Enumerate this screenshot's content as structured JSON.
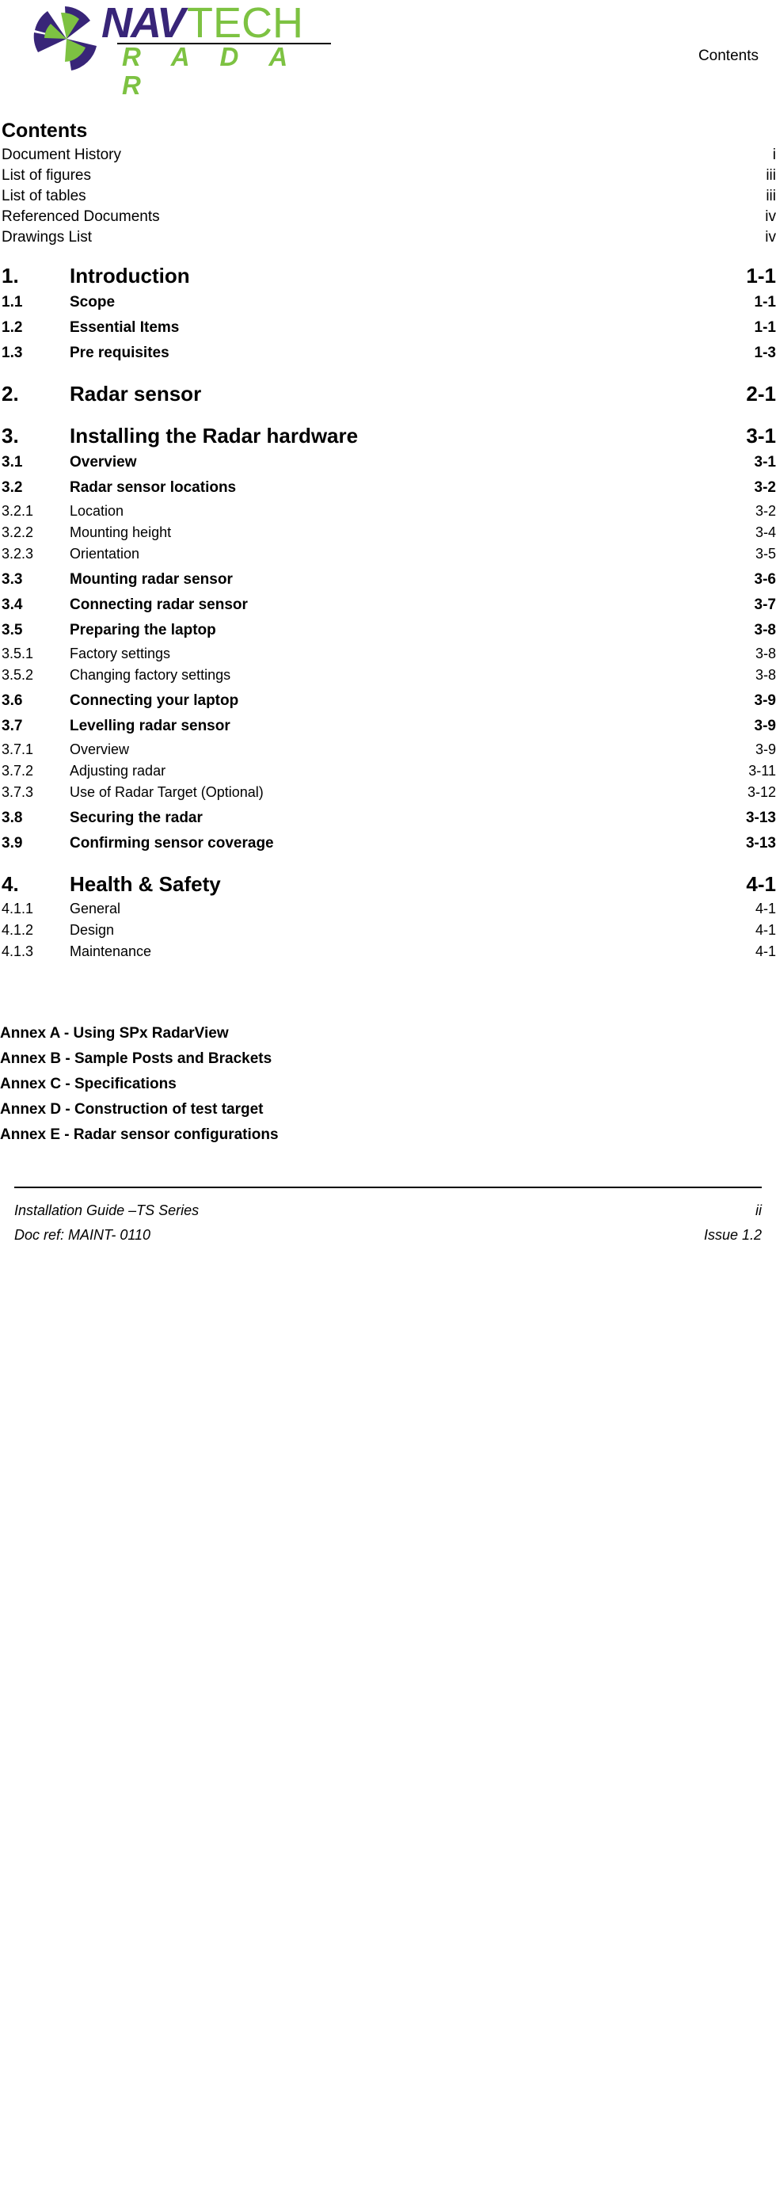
{
  "header": {
    "logo": {
      "brand_part1": "NAV",
      "brand_part2": "TECH",
      "brand_part3": "R A D A R",
      "color_purple": "#382578",
      "color_green": "#7dc242"
    },
    "running_title": "Contents"
  },
  "toc": {
    "heading": "Contents",
    "front_matter": [
      {
        "title": "Document History",
        "page": "i"
      },
      {
        "title": "List of figures",
        "page": "iii"
      },
      {
        "title": "List of tables",
        "page": "iii"
      },
      {
        "title": "Referenced Documents",
        "page": "iv"
      },
      {
        "title": "Drawings List",
        "page": "iv"
      }
    ],
    "entries": [
      {
        "num": "1.",
        "title": "Introduction",
        "page": "1-1",
        "level": 1
      },
      {
        "num": "1.1",
        "title": "Scope",
        "page": "1-1",
        "level": 2
      },
      {
        "num": "1.2",
        "title": "Essential Items",
        "page": "1-1",
        "level": 2
      },
      {
        "num": "1.3",
        "title": "Pre requisites",
        "page": "1-3",
        "level": 2
      },
      {
        "num": "2.",
        "title": "Radar sensor",
        "page": "2-1",
        "level": 1
      },
      {
        "num": "3.",
        "title": "Installing the Radar hardware",
        "page": "3-1",
        "level": 1
      },
      {
        "num": "3.1",
        "title": "Overview",
        "page": "3-1",
        "level": 2
      },
      {
        "num": "3.2",
        "title": "Radar sensor locations",
        "page": "3-2",
        "level": 2
      },
      {
        "num": "3.2.1",
        "title": "Location",
        "page": "3-2",
        "level": 3
      },
      {
        "num": "3.2.2",
        "title": "Mounting height",
        "page": "3-4",
        "level": 3
      },
      {
        "num": "3.2.3",
        "title": "Orientation",
        "page": "3-5",
        "level": 3
      },
      {
        "num": "3.3",
        "title": "Mounting radar sensor",
        "page": "3-6",
        "level": 2
      },
      {
        "num": "3.4",
        "title": "Connecting radar sensor",
        "page": "3-7",
        "level": 2
      },
      {
        "num": "3.5",
        "title": "Preparing the laptop",
        "page": "3-8",
        "level": 2
      },
      {
        "num": "3.5.1",
        "title": "Factory settings",
        "page": "3-8",
        "level": 3
      },
      {
        "num": "3.5.2",
        "title": "Changing factory settings",
        "page": "3-8",
        "level": 3
      },
      {
        "num": "3.6",
        "title": "Connecting your laptop",
        "page": "3-9",
        "level": 2
      },
      {
        "num": "3.7",
        "title": "Levelling radar sensor",
        "page": "3-9",
        "level": 2
      },
      {
        "num": "3.7.1",
        "title": "Overview",
        "page": "3-9",
        "level": 3
      },
      {
        "num": "3.7.2",
        "title": "Adjusting radar",
        "page": "3-11",
        "level": 3
      },
      {
        "num": "3.7.3",
        "title": "Use of Radar Target (Optional)",
        "page": "3-12",
        "level": 3
      },
      {
        "num": "3.8",
        "title": "Securing the radar",
        "page": "3-13",
        "level": 2
      },
      {
        "num": "3.9",
        "title": "Confirming sensor coverage",
        "page": "3-13",
        "level": 2
      },
      {
        "num": "4.",
        "title": "Health & Safety",
        "page": "4-1",
        "level": 1
      },
      {
        "num": "4.1.1",
        "title": "General",
        "page": "4-1",
        "level": 3
      },
      {
        "num": "4.1.2",
        "title": "Design",
        "page": "4-1",
        "level": 3
      },
      {
        "num": "4.1.3",
        "title": "Maintenance",
        "page": "4-1",
        "level": 3
      }
    ],
    "annexes": [
      {
        "title": "Annex A - Using SPx RadarView"
      },
      {
        "title": "Annex B - Sample Posts and Brackets"
      },
      {
        "title": "Annex C - Specifications"
      },
      {
        "title": "Annex D - Construction of test target"
      },
      {
        "title": "Annex E - Radar sensor configurations"
      }
    ]
  },
  "footer": {
    "doc_title": "Installation Guide –TS Series",
    "page_number": "ii",
    "doc_ref": "Doc ref: MAINT- 0110",
    "issue": "Issue 1.2"
  }
}
